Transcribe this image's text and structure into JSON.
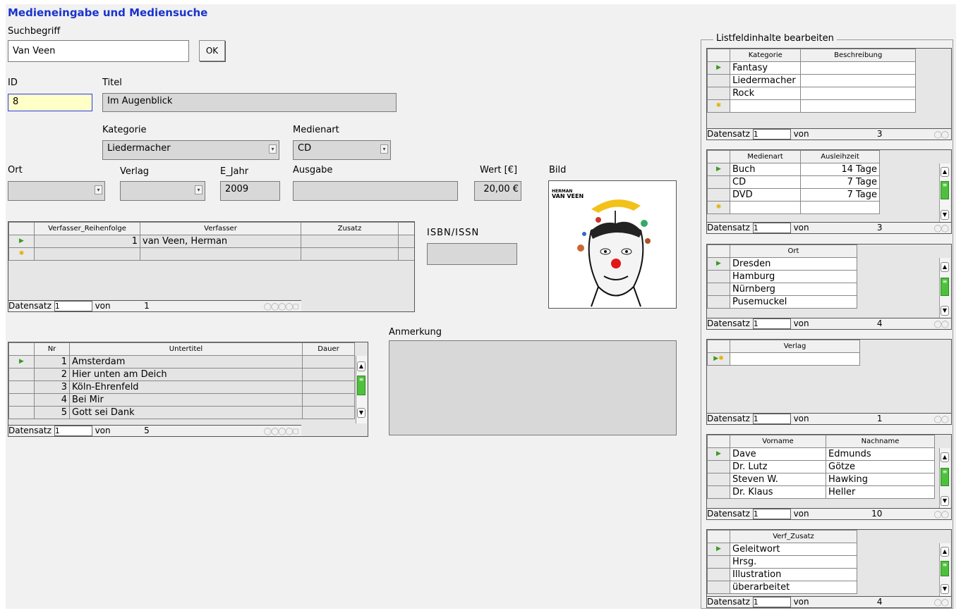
{
  "form_title": "Medieneingabe und Mediensuche",
  "search": {
    "label": "Suchbegriff",
    "value": "Van Veen",
    "ok_label": "OK"
  },
  "id_field": {
    "label": "ID",
    "value": "8"
  },
  "titel_field": {
    "label": "Titel",
    "value": "Im Augenblick"
  },
  "kategorie_field": {
    "label": "Kategorie",
    "value": "Liedermacher"
  },
  "medienart_field": {
    "label": "Medienart",
    "value": "CD"
  },
  "ort_field": {
    "label": "Ort",
    "value": ""
  },
  "verlag_field": {
    "label": "Verlag",
    "value": ""
  },
  "ejahr_field": {
    "label": "E_Jahr",
    "value": "2009"
  },
  "ausgabe_field": {
    "label": "Ausgabe",
    "value": ""
  },
  "wert_field": {
    "label": "Wert [€]",
    "value": "20,00 €"
  },
  "bild_label": "Bild",
  "isbn_label": "ISBN/ISSN",
  "anmerkung_label": "Anmerkung",
  "nav": {
    "record_label": "Datensatz",
    "of_label": "von"
  },
  "verfasser_grid": {
    "headers": [
      "Verfasser_Reihenfolge",
      "Verfasser",
      "Zusatz"
    ],
    "rows": [
      {
        "reihenfolge": "1",
        "verfasser": "van Veen, Herman",
        "zusatz": ""
      }
    ],
    "record": "1",
    "total": "1"
  },
  "untertitel_grid": {
    "headers": [
      "Nr",
      "Untertitel",
      "Dauer"
    ],
    "rows": [
      {
        "nr": "1",
        "titel": "Amsterdam"
      },
      {
        "nr": "2",
        "titel": "Hier unten am Deich"
      },
      {
        "nr": "3",
        "titel": "Köln-Ehrenfeld"
      },
      {
        "nr": "4",
        "titel": "Bei Mir"
      },
      {
        "nr": "5",
        "titel": "Gott sei Dank"
      }
    ],
    "record": "1",
    "total": "5"
  },
  "listfeld": {
    "legend": "Listfeldinhalte bearbeiten",
    "kategorie": {
      "headers": [
        "Kategorie",
        "Beschreibung"
      ],
      "rows": [
        "Fantasy",
        "Liedermacher",
        "Rock"
      ],
      "record": "1",
      "total": "3"
    },
    "medienart": {
      "headers": [
        "Medienart",
        "Ausleihzeit"
      ],
      "rows": [
        [
          "Buch",
          "14 Tage"
        ],
        [
          "CD",
          "7 Tage"
        ],
        [
          "DVD",
          "7 Tage"
        ]
      ],
      "record": "1",
      "total": "3"
    },
    "ort": {
      "headers": [
        "Ort"
      ],
      "rows": [
        "Dresden",
        "Hamburg",
        "Nürnberg",
        "Pusemuckel"
      ],
      "record": "1",
      "total": "4"
    },
    "verlag": {
      "headers": [
        "Verlag"
      ],
      "rows": [],
      "record": "1",
      "total": "1"
    },
    "personen": {
      "headers": [
        "Vorname",
        "Nachname"
      ],
      "rows": [
        [
          "Dave",
          "Edmunds"
        ],
        [
          "Dr. Lutz",
          "Götze"
        ],
        [
          "Steven W.",
          "Hawking"
        ],
        [
          "Dr. Klaus",
          "Heller"
        ]
      ],
      "record": "1",
      "total": "10"
    },
    "verf_zusatz": {
      "headers": [
        "Verf_Zusatz"
      ],
      "rows": [
        "Geleitwort",
        "Hrsg.",
        "Illustration",
        "überarbeitet"
      ],
      "record": "1",
      "total": "4"
    }
  }
}
